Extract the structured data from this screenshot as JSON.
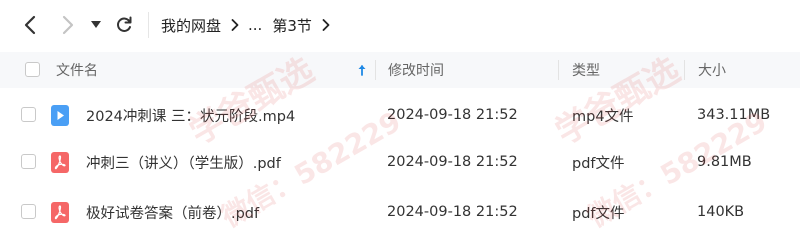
{
  "breadcrumb": {
    "root": "我的网盘",
    "ellipsis": "...",
    "current": "第3节"
  },
  "columns": {
    "name": "文件名",
    "modified": "修改时间",
    "type": "类型",
    "size": "大小"
  },
  "sort": {
    "column": "name",
    "direction": "ascending",
    "icon": "arrow-up-icon"
  },
  "files": [
    {
      "name": "2024冲刺课 三：状元阶段.mp4",
      "modified": "2024-09-18 21:52",
      "type": "mp4文件",
      "size": "343.11MB",
      "icon": "video-file-icon",
      "icon_color": "#4a9ff5"
    },
    {
      "name": "冲刺三（讲义）（学生版）.pdf",
      "modified": "2024-09-18 21:52",
      "type": "pdf文件",
      "size": "9.81MB",
      "icon": "pdf-file-icon",
      "icon_color": "#f56767"
    },
    {
      "name": "极好试卷答案（前卷）.pdf",
      "modified": "2024-09-18 21:52",
      "type": "pdf文件",
      "size": "140KB",
      "icon": "pdf-file-icon",
      "icon_color": "#f56767"
    }
  ],
  "watermark": {
    "line1": "学爸甄选",
    "line2": "微信：582229"
  },
  "colors": {
    "accent": "#1e88e5",
    "header_bg": "#f7f8fa",
    "watermark": "#dc3c3c"
  }
}
